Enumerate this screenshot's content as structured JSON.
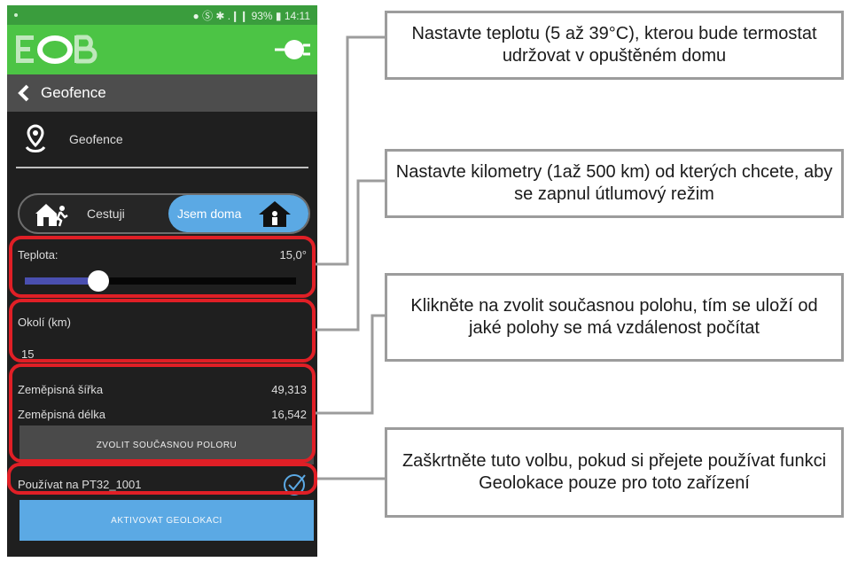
{
  "status_bar": {
    "right_text": "● Ⓢ ✱ .❙❙ 93% ▮ 14:11"
  },
  "appbar": {
    "logo_icon": "eob-logo",
    "plug_icon": "plug-icon",
    "color": "#4cc445"
  },
  "toolbar": {
    "title": "Geofence"
  },
  "geofence_row": {
    "label": "Geofence"
  },
  "mode_toggle": {
    "left_label": "Cestuji",
    "right_label": "Jsem doma",
    "selected": "Jsem doma"
  },
  "temperature": {
    "label": "Teplota:",
    "value": "15,0°",
    "slider_fraction": 0.27
  },
  "radius": {
    "label": "Okolí (km)",
    "value": "15"
  },
  "coords": {
    "lat_label": "Zeměpisná šířka",
    "lat_value": "49,313",
    "lon_label": "Zeměpisná délka",
    "lon_value": "16,542",
    "button_label": "ZVOLIT SOUČASNOU POLORU"
  },
  "device": {
    "label": "Používat na PT32_1001",
    "checked": true
  },
  "activate_button": {
    "label": "AKTIVOVAT GEOLOKACI"
  },
  "callouts": [
    {
      "text": "Nastavte teplotu (5 až 39°C), kterou bude termostat udržovat v opuštěném domu"
    },
    {
      "text": "Nastavte kilometry (1až 500 km) od kterých chcete, aby se zapnul útlumový režim"
    },
    {
      "text": "Klikněte na zvolit současnou polohu, tím se uloží od jaké polohy se má vzdálenost počítat"
    },
    {
      "text": "Zaškrtněte tuto volbu, pokud si přejete používat funkci Geolokace pouze pro toto zařízení"
    }
  ],
  "colors": {
    "highlight": "#e01f26",
    "accent_blue": "#5ba9e4",
    "callout_border": "#9c9c9c"
  }
}
